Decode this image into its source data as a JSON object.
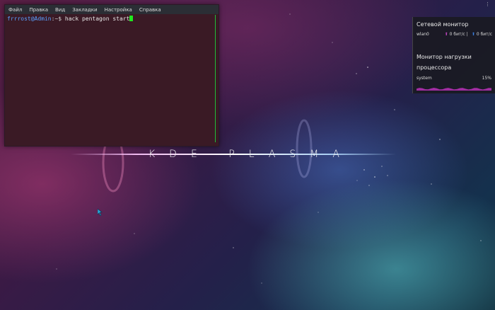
{
  "terminal": {
    "menu": [
      "Файл",
      "Правка",
      "Вид",
      "Закладки",
      "Настройка",
      "Справка"
    ],
    "prompt_user": "frrrost@Admin",
    "prompt_sep": ":~$ ",
    "command": "hack pentagon start"
  },
  "network_widget": {
    "title": "Сетевой монитор",
    "interface": "wlan0",
    "upload": "0 бит/с",
    "separator": "|",
    "download": "0 бит/с"
  },
  "cpu_widget": {
    "title_line1": "Монитор нагрузки",
    "title_line2": "процессора",
    "label": "system",
    "value": "15%",
    "load_fraction": 0.15,
    "graph_color": "#b030b0"
  },
  "wallpaper": {
    "logo_text": "KDE PLASMA"
  },
  "colors": {
    "cursor": "#1fe81f",
    "prompt_user": "#5aa0ff"
  }
}
